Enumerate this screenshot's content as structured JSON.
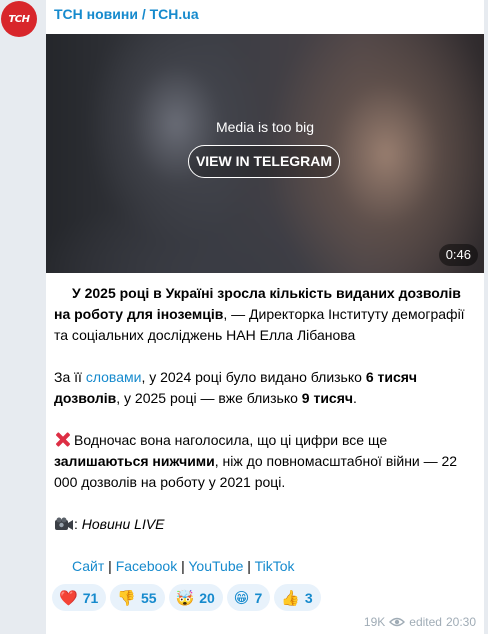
{
  "channel": {
    "avatar_text": "ТСН",
    "name": "ТСН новини / TCH.ua"
  },
  "media": {
    "caption": "Media is too big",
    "button_label": "VIEW IN TELEGRAM",
    "duration": "0:46"
  },
  "post": {
    "p1_bold": "У 2025 році в Україні зросла кількість виданих дозволів на роботу для іноземців",
    "p1_rest": ", — Директорка Інституту демографії та соціальних досліджень НАН Елла Лібанова",
    "p2_a": "За її ",
    "p2_link": "словами",
    "p2_b": ", у 2024 році було видано близько ",
    "p2_bold1": "6 тисяч дозволів",
    "p2_c": ", у 2025 році — вже близько ",
    "p2_bold2": "9 тисяч",
    "p2_d": ".",
    "p3_a": "Водночас вона наголосила, що ці цифри все ще ",
    "p3_bold": "залишаються нижчими",
    "p3_b": ", ніж до повномасштабної війни — 22 000 дозволів на роботу у 2021 році.",
    "p4_sep": ": ",
    "p4_italic": "Новини LIVE",
    "links": {
      "site": "Сайт",
      "facebook": "Facebook",
      "youtube": "YouTube",
      "tiktok": "TikTok",
      "separator": " | "
    }
  },
  "reactions": [
    {
      "emoji": "❤️",
      "count": "71"
    },
    {
      "emoji": "👎",
      "count": "55"
    },
    {
      "emoji": "🤯",
      "count": "20"
    },
    {
      "emoji": "😁",
      "count": "7"
    },
    {
      "emoji": "👍",
      "count": "3"
    }
  ],
  "meta": {
    "views": "19K",
    "edited_label": "edited",
    "time": "20:30"
  },
  "colors": {
    "link": "#168acd",
    "avatar_bg": "#d8262b",
    "reaction_bg": "#e8f2fb"
  }
}
